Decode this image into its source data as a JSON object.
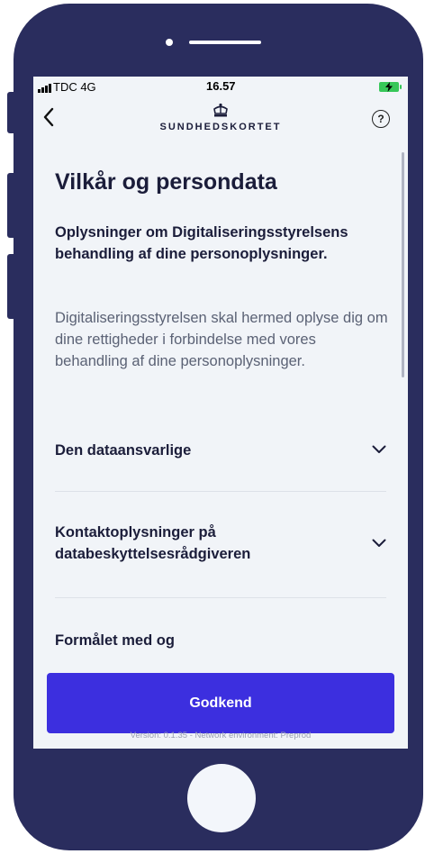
{
  "status_bar": {
    "carrier": "TDC 4G",
    "time": "16.57"
  },
  "header": {
    "brand": "SUNDHEDSKORTET",
    "help": "?"
  },
  "main": {
    "title": "Vilkår og persondata",
    "subtitle": "Oplysninger om Digitaliseringsstyrelsens behandling af dine personoplysninger.",
    "intro": "Digitaliseringsstyrelsen skal hermed oplyse dig om dine rettigheder i forbindelse med vores behandling af dine personoplysninger.",
    "sections": [
      {
        "label": "Den dataansvarlige"
      },
      {
        "label": "Kontaktoplysninger på databeskyttelsesrådgiveren"
      },
      {
        "label": "Formålet med og"
      }
    ]
  },
  "footer": {
    "approve_label": "Godkend",
    "version": "Version: 0.1.35 - Network environment:  Preprod"
  },
  "icons": {
    "back": "chevron-left-icon",
    "logo": "crown-icon",
    "help": "help-icon",
    "expand": "chevron-down-icon"
  },
  "colors": {
    "device": "#2a2d5e",
    "primary_button": "#3c2fdf",
    "text": "#1b1d3a",
    "muted_text": "#5b6275",
    "background": "#f1f4f8"
  }
}
